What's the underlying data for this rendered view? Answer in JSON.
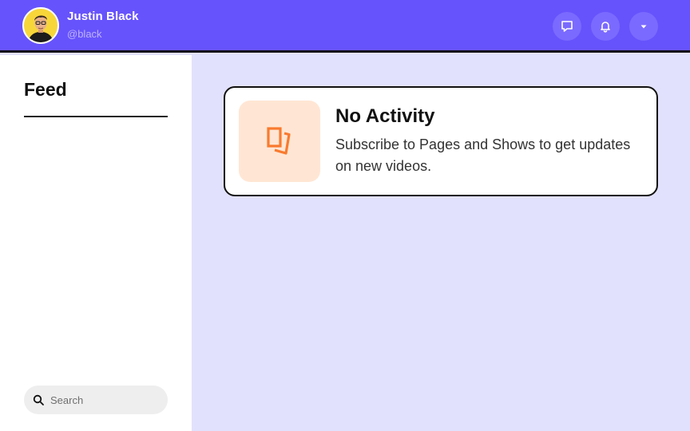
{
  "user": {
    "name": "Justin Black",
    "handle": "@black",
    "avatar_bg": "#f7d63a"
  },
  "header": {
    "background": "#6753fc",
    "actions": [
      {
        "icon": "message-icon",
        "label": "Messages"
      },
      {
        "icon": "bell-icon",
        "label": "Notifications"
      },
      {
        "icon": "caret-down-icon",
        "label": "Menu"
      }
    ]
  },
  "sidebar": {
    "title": "Feed",
    "search": {
      "placeholder": "Search",
      "value": ""
    }
  },
  "main": {
    "empty_state": {
      "title": "No Activity",
      "message": "Subscribe to Pages and Shows to get updates on new videos.",
      "icon": "stacked-pages-icon",
      "accent": "#f97a2e"
    }
  }
}
